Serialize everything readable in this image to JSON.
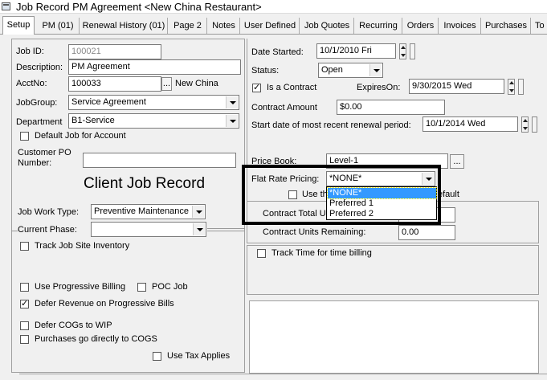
{
  "window": {
    "title": "Job Record PM Agreement <New China Restaurant>"
  },
  "tabs": [
    {
      "label": "Setup"
    },
    {
      "label": "PM (01)"
    },
    {
      "label": "Renewal History (01)"
    },
    {
      "label": "Page 2"
    },
    {
      "label": "Notes"
    },
    {
      "label": "User Defined"
    },
    {
      "label": "Job Quotes"
    },
    {
      "label": "Recurring"
    },
    {
      "label": "Orders"
    },
    {
      "label": "Invoices"
    },
    {
      "label": "Purchases"
    },
    {
      "label": "To"
    }
  ],
  "left": {
    "job_id_label": "Job ID:",
    "job_id_value": "100021",
    "description_label": "Description:",
    "description_value": "PM Agreement",
    "acctno_label": "AcctNo:",
    "acctno_value": "100033",
    "acct_lookup_label": "...",
    "acct_name": "New China",
    "jobgroup_label": "JobGroup:",
    "jobgroup_value": "Service Agreement",
    "department_label": "Department",
    "department_value": "B1-Service",
    "default_job_label": "Default Job for Account",
    "customer_po_label_1": "Customer PO",
    "customer_po_label_2": "Number:",
    "customer_po_value": "",
    "heading": "Client Job Record",
    "work_type_label": "Job Work Type:",
    "work_type_value": "Preventive Maintenance",
    "current_phase_label": "Current Phase:",
    "current_phase_value": "",
    "track_inventory_label": "Track Job Site Inventory",
    "progressive_billing_label": "Use Progressive Billing",
    "poc_job_label": "POC Job",
    "defer_revenue_label": "Defer Revenue on Progressive Bills",
    "defer_cogs_label": "Defer COGs to WIP",
    "purchases_cogs_label": "Purchases go directly to COGS",
    "use_tax_label": "Use Tax Applies"
  },
  "right": {
    "date_started_label": "Date Started:",
    "date_started_value": "10/1/2010 Fri",
    "status_label": "Status:",
    "status_value": "Open",
    "is_contract_label": "Is a Contract",
    "expires_on_label": "ExpiresOn:",
    "expires_on_value": "9/30/2015 Wed",
    "contract_amount_label": "Contract Amount",
    "contract_amount_value": "$0.00",
    "renewal_period_label": "Start date of most recent renewal period:",
    "renewal_period_value": "10/1/2014 Wed",
    "price_book_label": "Price Book:",
    "price_book_value": "Level-1",
    "price_book_lookup_label": "...",
    "flat_rate_label": "Flat Rate Pricing:",
    "flat_rate_value": "*NONE*",
    "use_the_label_start": "Use th",
    "use_the_label_end": "efault",
    "contract_total_label": "Contract Total U",
    "contract_remaining_label": "Contract Units Remaining:",
    "contract_remaining_value": "0.00",
    "track_time_label": "Track Time for time billing"
  },
  "dropdown_options": [
    "*NONE*",
    "Preferred 1",
    "Preferred 2"
  ],
  "checkbox_states": {
    "default_job": false,
    "is_contract": true,
    "use_the": false,
    "track_inventory": false,
    "progressive_billing": false,
    "poc_job": false,
    "defer_revenue": true,
    "defer_cogs": false,
    "purchases_cogs": false,
    "use_tax": false,
    "track_time": false
  },
  "colors": {
    "selection": "#3399ff",
    "callout_border": "#000000"
  }
}
